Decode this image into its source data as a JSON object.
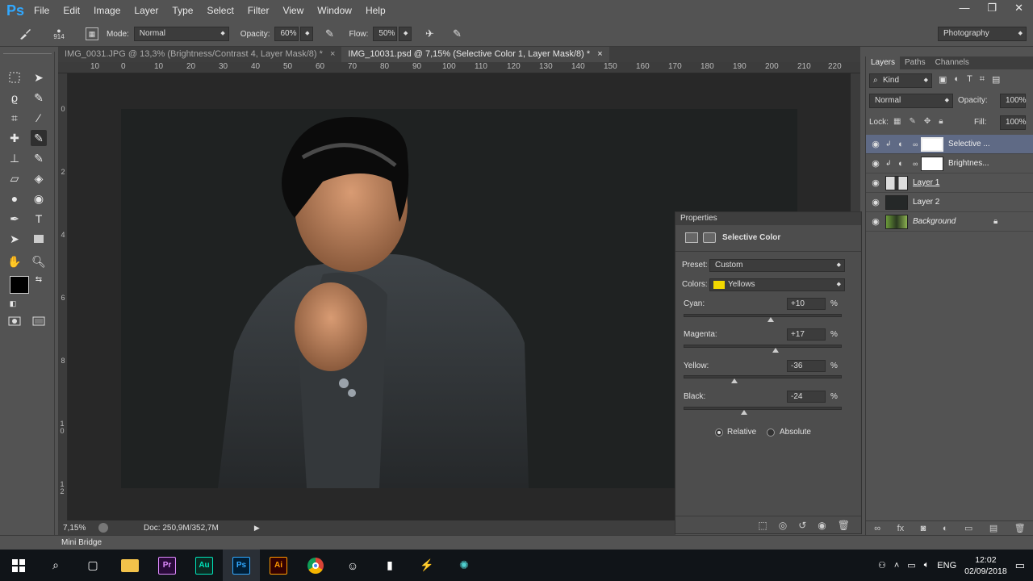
{
  "app": {
    "logo": "Ps"
  },
  "menu": [
    "File",
    "Edit",
    "Image",
    "Layer",
    "Type",
    "Select",
    "Filter",
    "View",
    "Window",
    "Help"
  ],
  "window_controls": [
    "—",
    "❐",
    "✕"
  ],
  "options": {
    "brush_size": "914",
    "mode_label": "Mode:",
    "mode_value": "Normal",
    "opacity_label": "Opacity:",
    "opacity_value": "60%",
    "flow_label": "Flow:",
    "flow_value": "50%",
    "workspace": "Photography"
  },
  "tabs": [
    {
      "label": "IMG_0031.JPG @ 13,3% (Brightness/Contrast 4, Layer Mask/8) *",
      "close": "×"
    },
    {
      "label": "IMG_10031.psd @ 7,15% (Selective Color 1, Layer Mask/8) *",
      "close": "×"
    }
  ],
  "ruler_top": [
    "10",
    "0",
    "10",
    "20",
    "30",
    "40",
    "50",
    "60",
    "70",
    "80",
    "90",
    "100",
    "110",
    "120",
    "130",
    "140",
    "150",
    "160",
    "170",
    "180",
    "190",
    "200",
    "210",
    "220"
  ],
  "ruler_left": [
    "0",
    "2",
    "4",
    "6",
    "8",
    "10",
    "12"
  ],
  "status": {
    "zoom": "7,15%",
    "doc": "Doc: 250,9M/352,7M"
  },
  "mini_bridge": "Mini Bridge",
  "properties": {
    "title": "Properties",
    "adjustment": "Selective Color",
    "preset_label": "Preset:",
    "preset_value": "Custom",
    "colors_label": "Colors:",
    "colors_value": "Yellows",
    "sliders": [
      {
        "name": "Cyan:",
        "value": "+10",
        "level": 10
      },
      {
        "name": "Magenta:",
        "value": "+17",
        "level": 17
      },
      {
        "name": "Yellow:",
        "value": "-36",
        "level": -36
      },
      {
        "name": "Black:",
        "value": "-24",
        "level": -24
      }
    ],
    "pct": "%",
    "relative": "Relative",
    "absolute": "Absolute"
  },
  "layers_panel": {
    "tabs": [
      "Layers",
      "Paths",
      "Channels"
    ],
    "kind": "Kind",
    "blend": "Normal",
    "opacity_label": "Opacity:",
    "opacity_value": "100%",
    "lock_label": "Lock:",
    "fill_label": "Fill:",
    "fill_value": "100%",
    "layers": [
      {
        "name": "Selective ...",
        "selected": true
      },
      {
        "name": "Brightnes...",
        "selected": false
      },
      {
        "name": "Layer 1",
        "selected": false
      },
      {
        "name": "Layer 2",
        "selected": false
      },
      {
        "name": "Background",
        "selected": false
      }
    ]
  },
  "taskbar": {
    "apps": [
      "Pr",
      "Au",
      "Ps",
      "Ai"
    ],
    "lang": "ENG",
    "time": "12:02",
    "date": "02/09/2018"
  },
  "colors": {
    "accent": "#31a8ff",
    "selected_layer": "#5f6a85",
    "yellow_swatch": "#f2d800"
  }
}
